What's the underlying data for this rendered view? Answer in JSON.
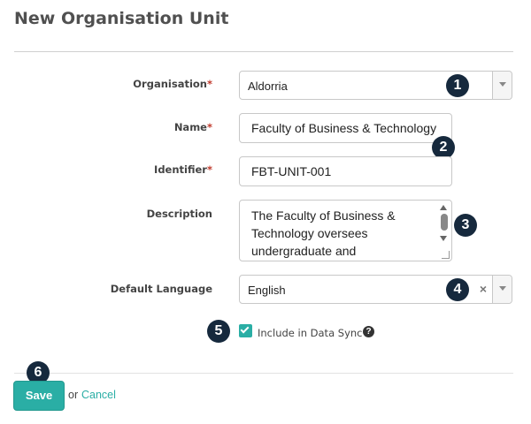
{
  "page": {
    "title": "New Organisation Unit"
  },
  "fields": {
    "organisation": {
      "label": "Organisation",
      "required_mark": "*",
      "value": "Aldorria"
    },
    "name": {
      "label": "Name",
      "required_mark": "*",
      "value": "Faculty of Business & Technology"
    },
    "identifier": {
      "label": "Identifier",
      "required_mark": "*",
      "value": "FBT-UNIT-001"
    },
    "description": {
      "label": "Description",
      "value": "The Faculty of Business & Technology oversees undergraduate and"
    },
    "default_language": {
      "label": "Default Language",
      "value": "English",
      "clear_glyph": "×"
    },
    "data_sync": {
      "label": "Include in Data Sync",
      "checked": true,
      "help_glyph": "?"
    }
  },
  "badges": [
    "1",
    "2",
    "3",
    "4",
    "5",
    "6"
  ],
  "footer": {
    "save_label": "Save",
    "or_text": "or",
    "cancel_label": "Cancel"
  },
  "colors": {
    "accent": "#2aaea5",
    "badge": "#16293d",
    "required": "#c0392b"
  }
}
